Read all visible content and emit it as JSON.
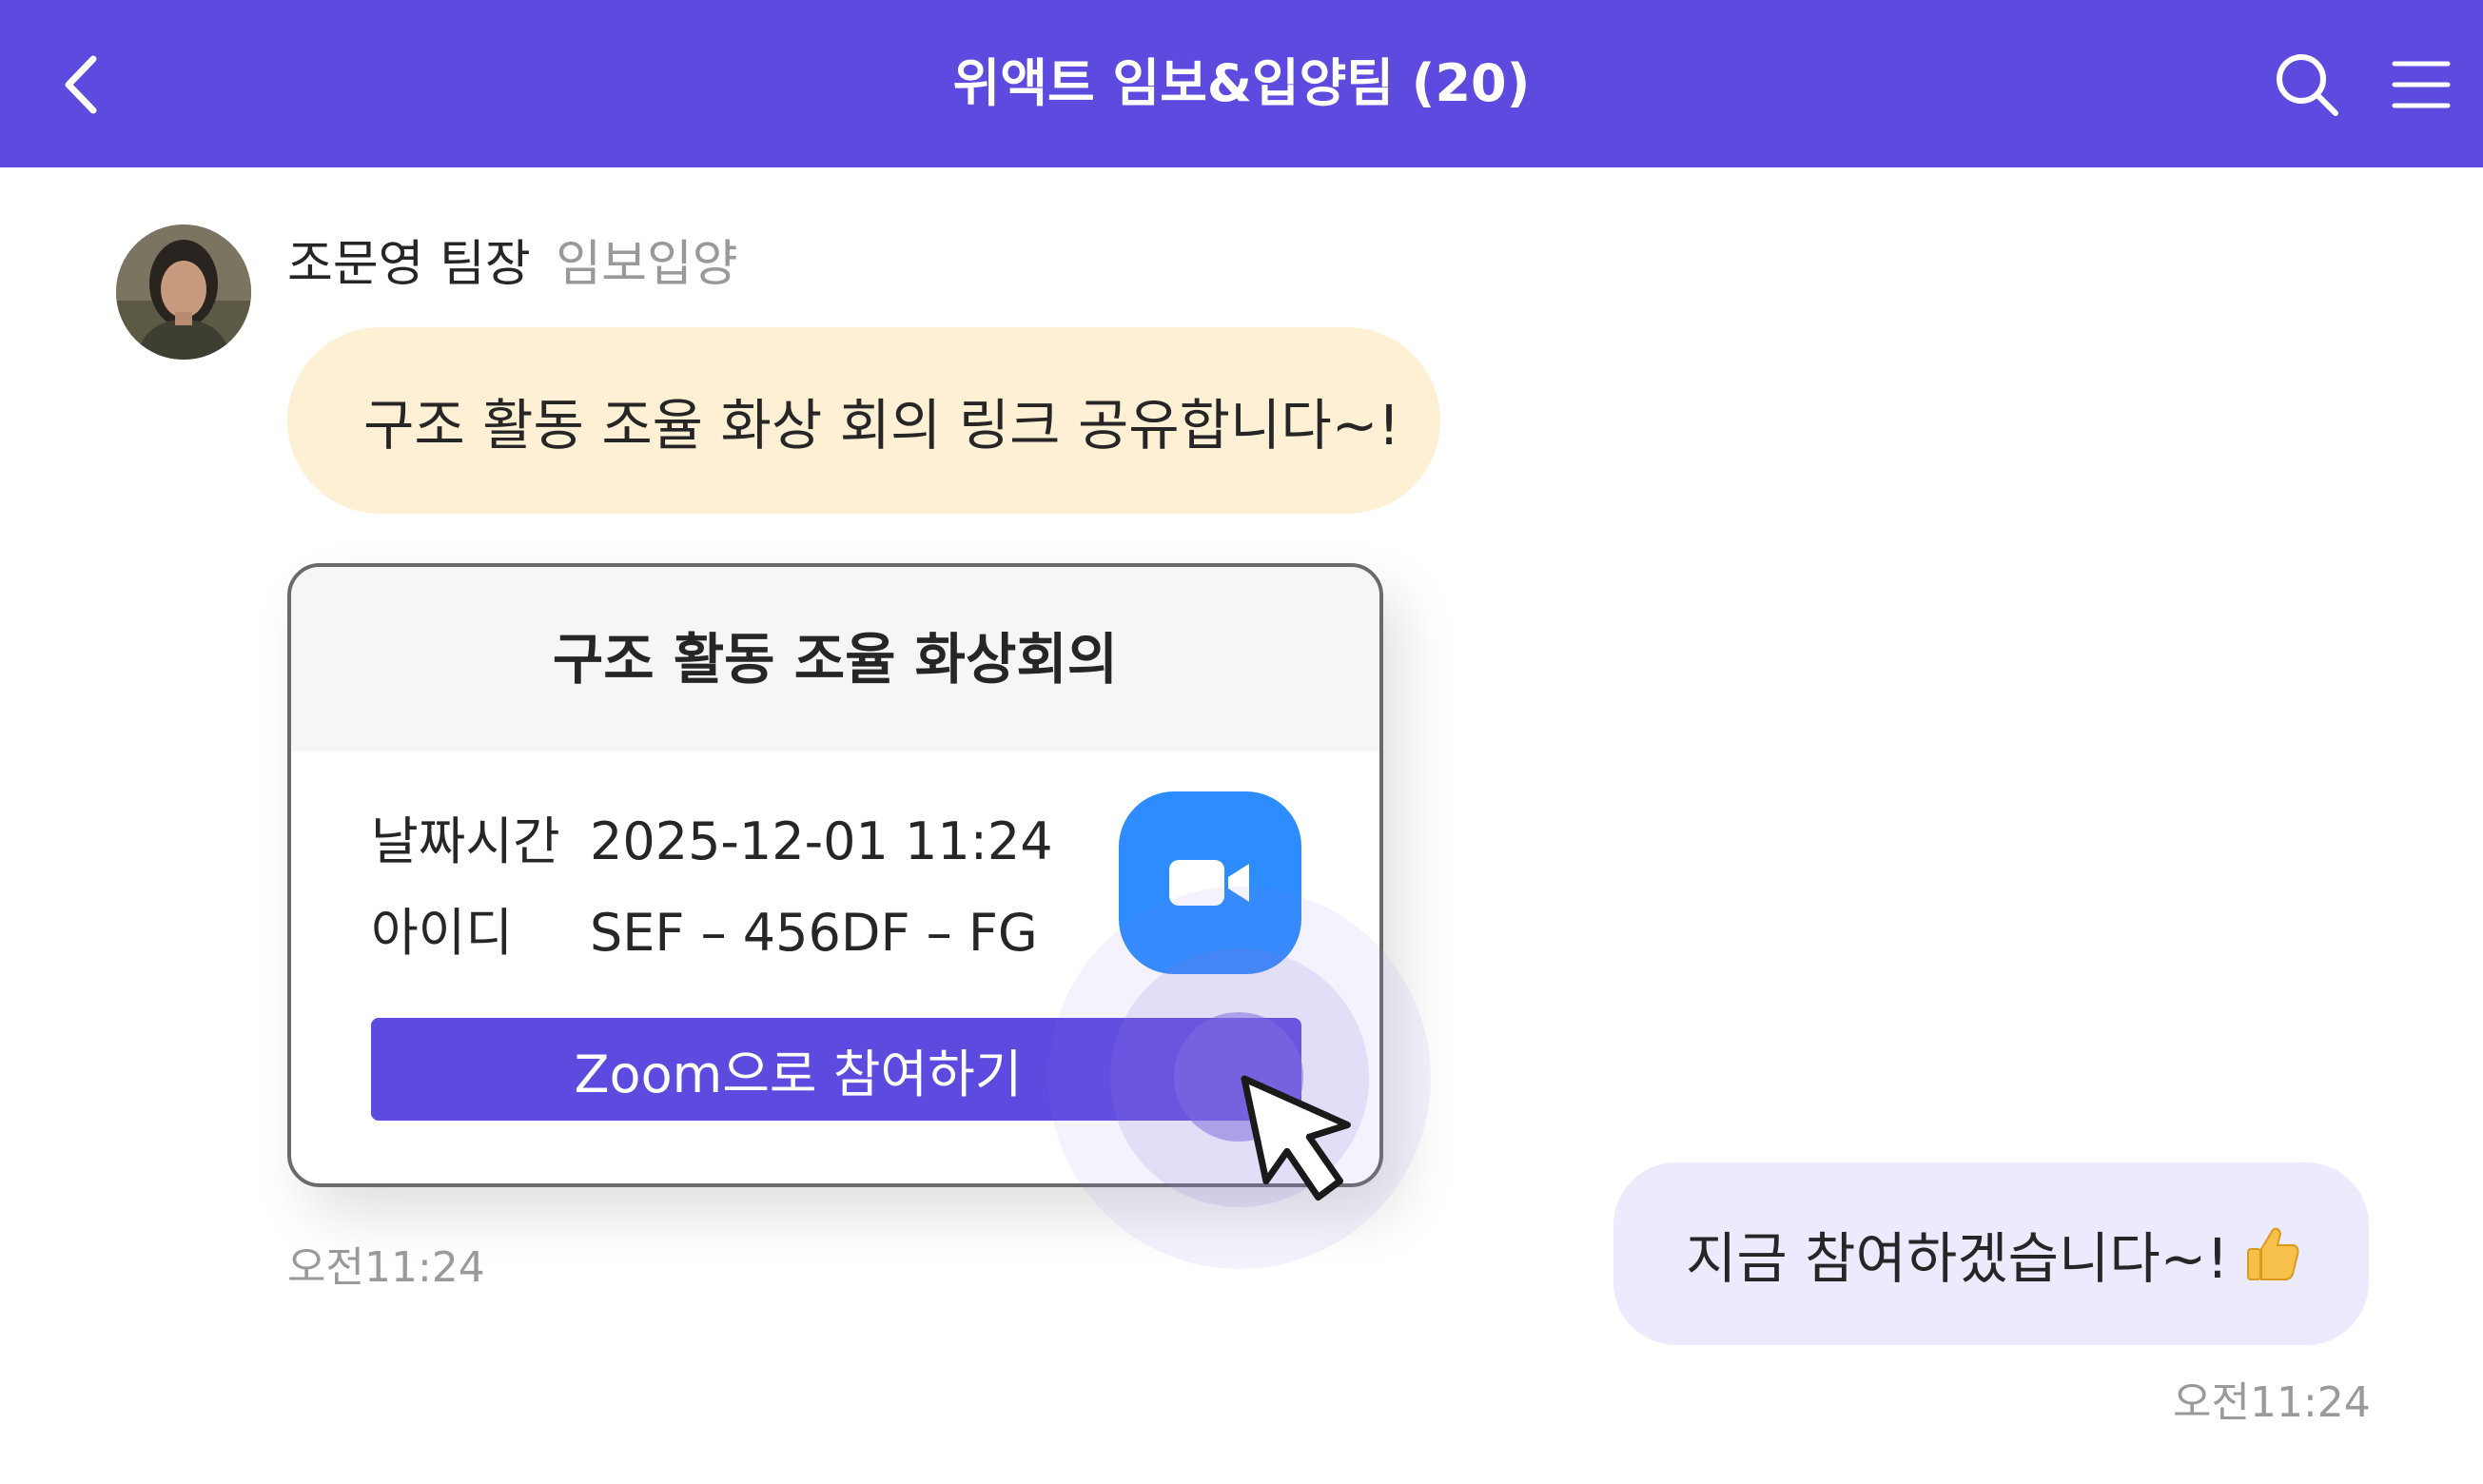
{
  "header": {
    "title": "위액트 임보&입양팀 (20)",
    "icons": {
      "back": "chevron-left-icon",
      "search": "search-icon",
      "menu": "hamburger-menu-icon"
    },
    "background_color": "#5d4adf"
  },
  "messages": {
    "incoming": {
      "sender_name": "조문영 팀장",
      "sender_team": "임보입양",
      "text": "구조 활동 조율 화상 회의 링크 공유합니다~!",
      "bubble_color": "#fdf0d5",
      "time": "오전11:24"
    },
    "outgoing": {
      "text": "지금 참여하겠습니다~!",
      "emoji": "thumbs-up-icon",
      "bubble_color": "#eceafd",
      "time": "오전11:24"
    }
  },
  "meeting_card": {
    "title": "구조 활동 조율 화상회의",
    "rows": [
      {
        "label": "날짜시간",
        "value": "2025-12-01 11:24"
      },
      {
        "label": "아이디",
        "value": "SEF – 456DF – FG"
      }
    ],
    "join_button_label": "Zoom으로 참여하기",
    "zoom_icon": "zoom-camera-icon",
    "zoom_color": "#2d8cff",
    "button_color": "#5d4adf"
  }
}
